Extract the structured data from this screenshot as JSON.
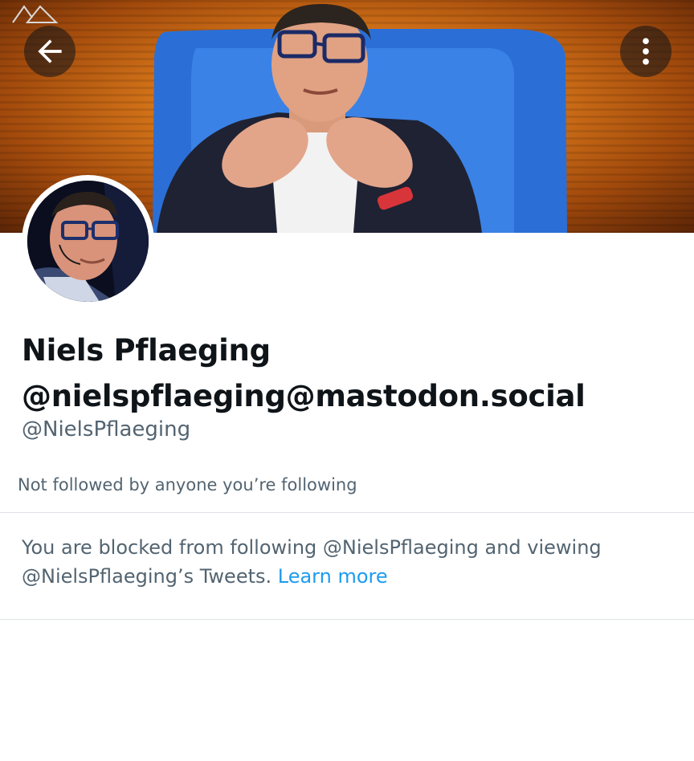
{
  "profile": {
    "display_name_line1": "Niels Pflaeging",
    "display_name_line2": "@nielspflaeging@mastodon.social",
    "handle": "@NielsPflaeging",
    "followers_note": "Not followed by anyone you’re following"
  },
  "blocked": {
    "message": "You are blocked from following @NielsPflaeging and viewing @NielsPflaeging’s Tweets.",
    "link_label": "Learn more"
  },
  "icons": {
    "back": "arrow-left-icon",
    "more": "more-vertical-icon"
  },
  "colors": {
    "text_primary": "#0f1419",
    "text_secondary": "#536471",
    "link": "#1d9bf0",
    "divider": "#dfe3e7"
  }
}
